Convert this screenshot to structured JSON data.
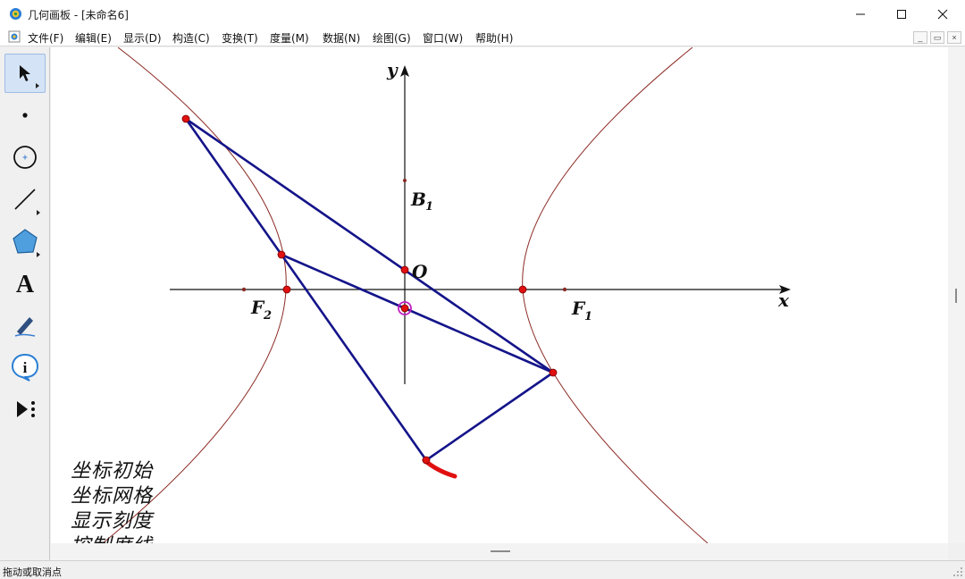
{
  "window": {
    "title": "几何画板 - [未命名6]"
  },
  "menu": {
    "items": [
      "文件(F)",
      "编辑(E)",
      "显示(D)",
      "构造(C)",
      "变换(T)",
      "度量(M)",
      "数据(N)",
      "绘图(G)",
      "窗口(W)",
      "帮助(H)"
    ]
  },
  "toolbox": {
    "tools": [
      {
        "name": "move-arrow-tool",
        "icon": "arrow-cursor-icon"
      },
      {
        "name": "point-tool",
        "icon": "point-icon"
      },
      {
        "name": "compass-tool",
        "icon": "circle-icon"
      },
      {
        "name": "straightedge-tool",
        "icon": "segment-icon"
      },
      {
        "name": "polygon-tool",
        "icon": "polygon-icon"
      },
      {
        "name": "text-tool",
        "icon": "text-A-icon",
        "glyph": "A"
      },
      {
        "name": "marker-tool",
        "icon": "pen-icon"
      },
      {
        "name": "information-tool",
        "icon": "info-icon",
        "glyph": "i"
      },
      {
        "name": "custom-tool",
        "icon": "custom-tool-icon"
      }
    ]
  },
  "canvas": {
    "axis_labels": {
      "x": "x",
      "y": "y"
    },
    "point_labels": {
      "B1_main": "B",
      "B1_sub": "1",
      "O": "O",
      "F1_main": "F",
      "F1_sub": "1",
      "F2_main": "F",
      "F2_sub": "2"
    },
    "action_buttons": [
      "坐标初始",
      "坐标网格",
      "显示刻度",
      "控制度线"
    ],
    "colors": {
      "hyperbola": "#8b2a24",
      "segments": "#14148a",
      "points": "#e01010",
      "selected_point_ring": "#c020c0",
      "axis": "#111111"
    }
  },
  "status": {
    "text": "拖动或取消点"
  }
}
